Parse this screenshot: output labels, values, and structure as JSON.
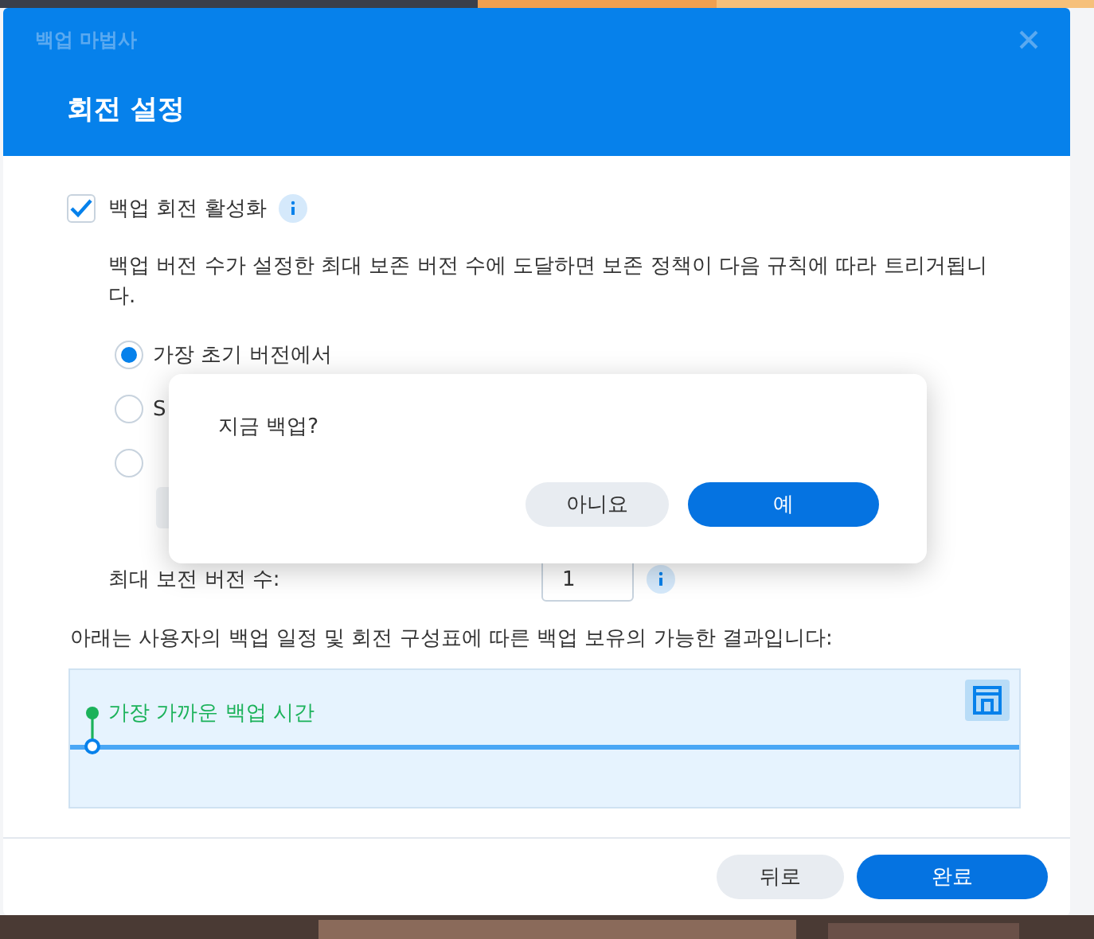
{
  "window": {
    "title": "백업 마법사",
    "heading": "회전 설정"
  },
  "enable_rotation": {
    "label": "백업 회전 활성화",
    "checked": true
  },
  "description": "백업 버전 수가 설정한 최대 보존 버전 수에 도달하면 보존 정책이 다음 규칙에 따라 트리거됩니다.",
  "rotation_options": [
    {
      "label": "가장 초기 버전에서",
      "selected": true
    },
    {
      "label": "S",
      "selected": false
    },
    {
      "selected": false
    }
  ],
  "max_versions": {
    "label": "최대 보전 버전 수:",
    "value": "1"
  },
  "result_text": "아래는 사용자의 백업 일정 및 회전 구성표에 따른 백업 보유의 가능한 결과입니다:",
  "timeline": {
    "label": "가장 가까운 백업 시간"
  },
  "footer_buttons": [
    {
      "label": "뒤로",
      "kind": "secondary"
    },
    {
      "label": "완료",
      "kind": "primary"
    }
  ],
  "popup": {
    "message": "지금 백업?",
    "buttons": [
      {
        "label": "아니요",
        "kind": "secondary"
      },
      {
        "label": "예",
        "kind": "primary"
      }
    ]
  }
}
